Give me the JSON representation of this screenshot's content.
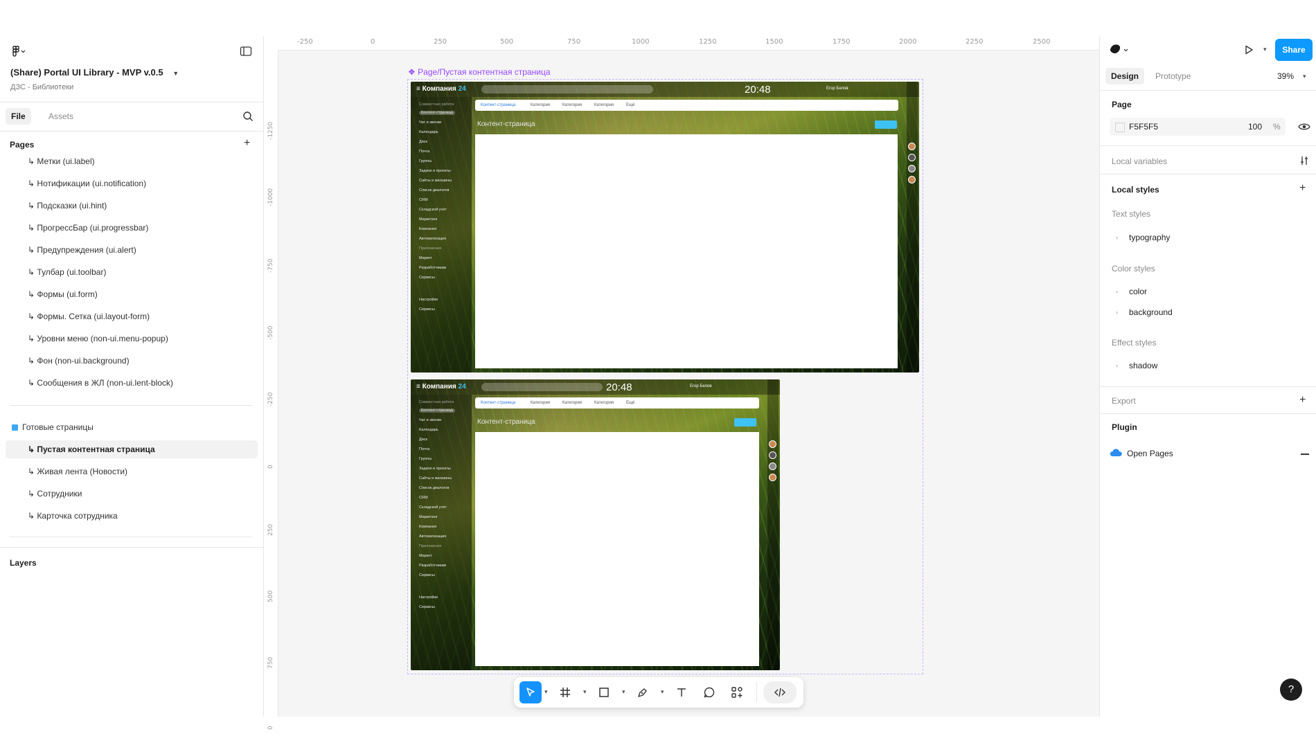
{
  "file": {
    "title": "(Share) Portal UI Library - MVP v.0.5",
    "project": "ДЗС - Библиотеки"
  },
  "left_tabs": [
    "File",
    "Assets"
  ],
  "pages_title": "Pages",
  "pages": [
    {
      "label": "Метки (ui.label)",
      "prefix": "↳"
    },
    {
      "label": "Нотификации (ui.notification)",
      "prefix": "↳"
    },
    {
      "label": "Подсказки (ui.hint)",
      "prefix": "↳"
    },
    {
      "label": "ПрогрессБар (ui.progressbar)",
      "prefix": "↳"
    },
    {
      "label": "Предупреждения (ui.alert)",
      "prefix": "↳"
    },
    {
      "label": "Тулбар (ui.toolbar)",
      "prefix": "↳"
    },
    {
      "label": "Формы (ui.form)",
      "prefix": "↳"
    },
    {
      "label": "Формы. Сетка (ui.layout-form)",
      "prefix": "↳"
    },
    {
      "label": "Уровни меню (non-ui.menu-popup)",
      "prefix": "↳"
    },
    {
      "label": "Фон (non-ui.background)",
      "prefix": "↳"
    },
    {
      "label": "Сообщения в ЖЛ (non-ui.lent-block)",
      "prefix": "↳"
    }
  ],
  "ready_pages": {
    "group_label": "Готовые страницы",
    "items": [
      {
        "label": "Пустая контентная страница",
        "prefix": "↳",
        "selected": true
      },
      {
        "label": "Живая лента (Новости)",
        "prefix": "↳"
      },
      {
        "label": "Сотрудники",
        "prefix": "↳"
      },
      {
        "label": "Карточка сотрудника",
        "prefix": "↳"
      }
    ]
  },
  "layers_title": "Layers",
  "ruler_x": [
    "-250",
    "0",
    "250",
    "500",
    "750",
    "1000",
    "1250",
    "1500",
    "1750",
    "2000",
    "2250",
    "2500"
  ],
  "ruler_y": [
    "-1250",
    "-1000",
    "-750",
    "-500",
    "-250",
    "0",
    "250",
    "500",
    "750",
    "0"
  ],
  "canvas": {
    "frame_label": "❖ Page/Пустая контентная страница",
    "shot": {
      "brand": "Компания",
      "brand_suffix": "24",
      "time": "20:48",
      "user": "Егор Белов",
      "tabs": [
        "Контент-страница",
        "Категория",
        "Категория",
        "Категория",
        "Ещё"
      ],
      "content_title": "Контент-страница",
      "sidebar": [
        "Совместная работа",
        "Контент-страница",
        "Чат и звонки",
        "Календарь",
        "Диск",
        "Почта",
        "Группы",
        "Задачи и проекты",
        "Сайты и магазины",
        "Список диалогов",
        "CRM",
        "Складской учёт",
        "Маркетинг",
        "Компания",
        "Автоматизация",
        "Приложения",
        "Маркет",
        "Разработчикам",
        "Сервисы",
        "Настройки",
        "Сервисы"
      ]
    }
  },
  "toolbar": {
    "tools": [
      "move-tool",
      "frame-tool",
      "shape-tool",
      "pen-tool",
      "text-tool",
      "comment-tool",
      "components-tool",
      "dev-mode-toggle"
    ]
  },
  "right": {
    "tabs": [
      "Design",
      "Prototype"
    ],
    "zoom": "39%",
    "share_label": "Share",
    "page_title": "Page",
    "page_color": "F5F5F5",
    "page_opacity": "100",
    "page_opacity_unit": "%",
    "local_variables": "Local variables",
    "local_styles": "Local styles",
    "text_styles": "Text styles",
    "text_style_items": [
      "typography"
    ],
    "color_styles": "Color styles",
    "color_style_items": [
      "color",
      "background"
    ],
    "effect_styles": "Effect styles",
    "effect_style_items": [
      "shadow"
    ],
    "export": "Export",
    "plugin": "Plugin",
    "plugin_item": "Open Pages"
  },
  "help_label": "?"
}
